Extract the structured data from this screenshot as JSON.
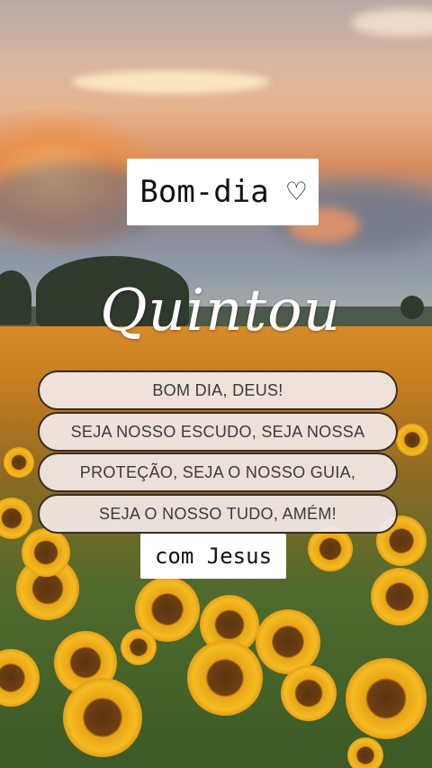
{
  "greeting": "Bom-dia ♡",
  "script_title": "Quintou",
  "prayer_lines": [
    "BOM DIA, DEUS!",
    "SEJA NOSSO ESCUDO, SEJA NOSSA",
    "PROTEÇÃO, SEJA O NOSSO GUIA,",
    "SEJA O NOSSO TUDO, AMÉM!"
  ],
  "footer": "com Jesus"
}
